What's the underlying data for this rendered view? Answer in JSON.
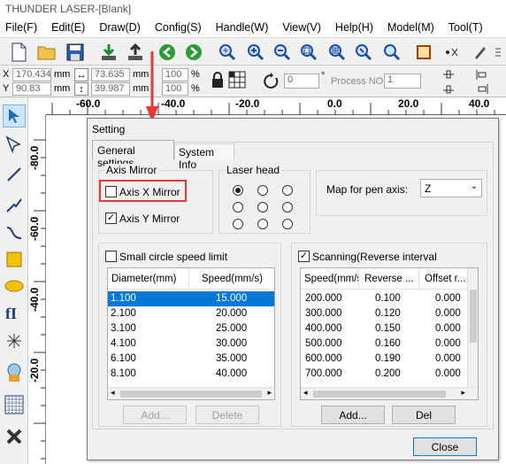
{
  "app": {
    "title": "THUNDER LASER-[Blank]"
  },
  "menu": [
    "File(F)",
    "Edit(E)",
    "Draw(D)",
    "Config(S)",
    "Handle(W)",
    "View(V)",
    "Help(H)",
    "Model(M)",
    "Tool(T)"
  ],
  "coords": {
    "x_label": "X",
    "x_value": "170.434",
    "y_label": "Y",
    "y_value": "90.83",
    "unit": "mm",
    "width_value": "73.635",
    "height_value": "39.987",
    "scale_x": "100",
    "scale_y": "100",
    "percent": "%",
    "rotate_value": "0",
    "degree": "°",
    "process_label": "Process NO:",
    "process_value": "1"
  },
  "ruler": {
    "h_labels": [
      "-60.0",
      "-40.0",
      "-20.0",
      "0.0",
      "20.0",
      "40.0"
    ],
    "v_labels": [
      "-80.0",
      "-60.0",
      "-40.0",
      "-20.0"
    ]
  },
  "dialog": {
    "title": "Setting",
    "tabs": [
      "General settings",
      "System Info"
    ],
    "axis_mirror": {
      "title": "Axis Mirror",
      "x_label": "Axis X Mirror",
      "x_checked": false,
      "y_label": "Axis Y Mirror",
      "y_checked": true
    },
    "laser_head": {
      "title": "Laser head",
      "selected_index": 0
    },
    "pen_axis": {
      "label": "Map for pen axis:",
      "value": "Z"
    },
    "small_circle": {
      "label": "Small circle speed limit",
      "checked": false,
      "columns": [
        "Diameter(mm)",
        "Speed(mm/s)"
      ],
      "rows": [
        [
          "1.100",
          "15.000"
        ],
        [
          "2.100",
          "20.000"
        ],
        [
          "3.100",
          "25.000"
        ],
        [
          "4.100",
          "30.000"
        ],
        [
          "6.100",
          "35.000"
        ],
        [
          "8.100",
          "40.000"
        ]
      ],
      "selected_row": 0,
      "add_label": "Add...",
      "delete_label": "Delete"
    },
    "scanning": {
      "label": "Scanning(Reverse interval",
      "checked": true,
      "columns": [
        "Speed(mm/s)",
        "Reverse ...",
        "Offset r..."
      ],
      "rows": [
        [
          "200.000",
          "0.100",
          "0.000"
        ],
        [
          "300.000",
          "0.120",
          "0.000"
        ],
        [
          "400.000",
          "0.150",
          "0.000"
        ],
        [
          "500.000",
          "0.160",
          "0.000"
        ],
        [
          "600.000",
          "0.190",
          "0.000"
        ],
        [
          "700.000",
          "0.200",
          "0.000"
        ]
      ],
      "add_label": "Add...",
      "delete_label": "Del"
    },
    "close_label": "Close"
  },
  "colors": {
    "highlight": "#e53935",
    "selection": "#0078d7",
    "accent_arrow": "#e53935"
  }
}
